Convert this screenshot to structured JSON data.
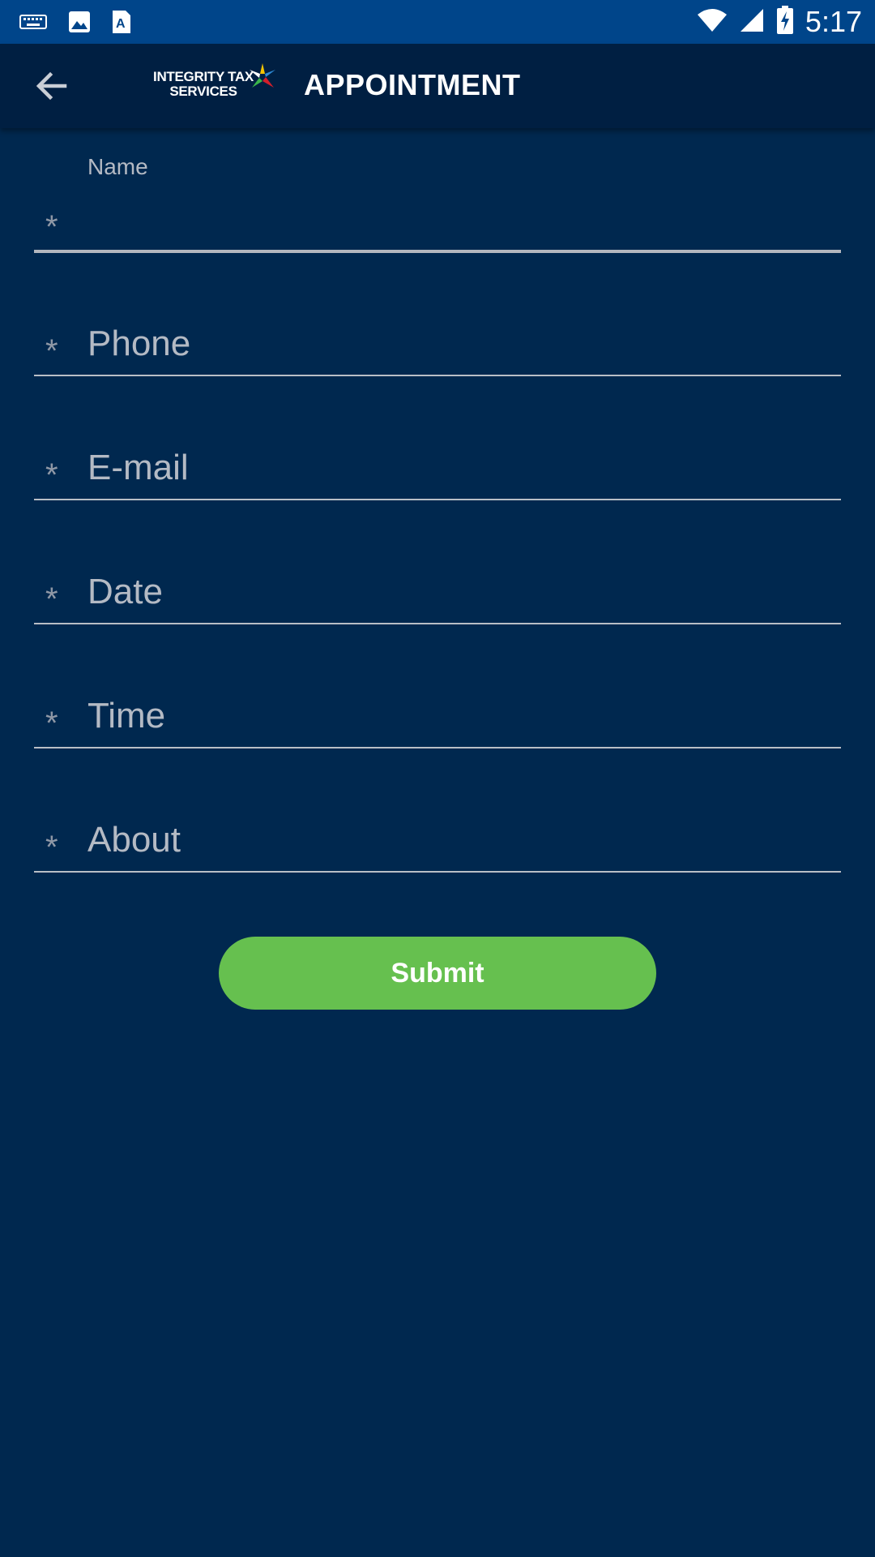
{
  "status_bar": {
    "time": "5:17",
    "icons": [
      "keyboard-icon",
      "image-icon",
      "font-icon",
      "wifi-icon",
      "signal-icon",
      "battery-charging-icon"
    ]
  },
  "app_bar": {
    "logo_line1": "INTEGRITY TAX",
    "logo_line2": "SERVICES",
    "title": "APPOINTMENT"
  },
  "form": {
    "required_marker": "*",
    "fields": [
      {
        "label": "Name",
        "value": ""
      },
      {
        "placeholder": "Phone"
      },
      {
        "placeholder": "E-mail"
      },
      {
        "placeholder": "Date"
      },
      {
        "placeholder": "Time"
      },
      {
        "placeholder": "About"
      }
    ],
    "submit_label": "Submit"
  },
  "colors": {
    "background": "#00284f",
    "status_bar": "#00458a",
    "app_bar": "#001f42",
    "submit": "#66c04f"
  }
}
